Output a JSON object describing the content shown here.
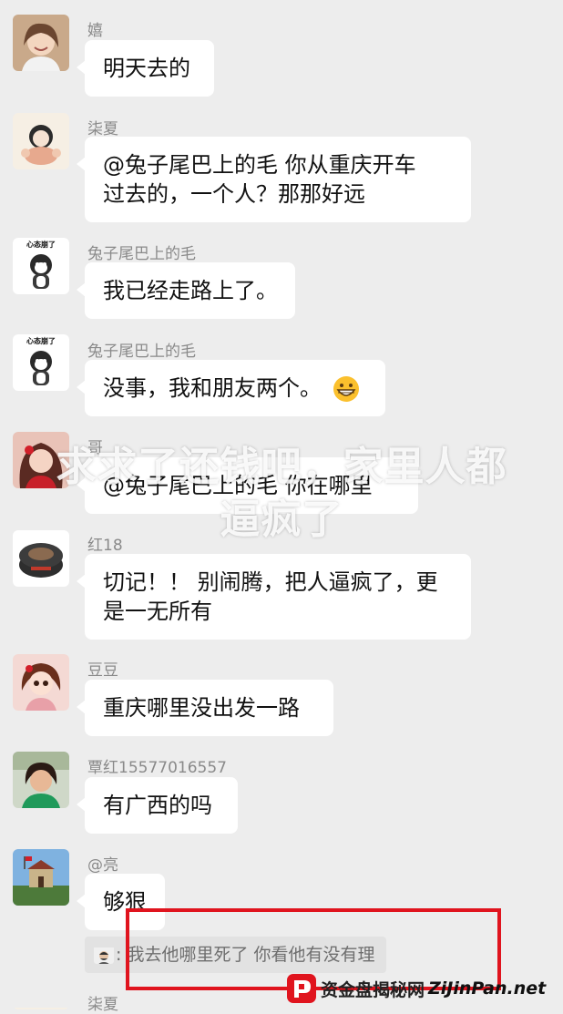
{
  "messages": [
    {
      "name": "嬉",
      "lines": [
        "明天去的"
      ]
    },
    {
      "name": "柒夏",
      "lines": [
        "@兔子尾巴上的毛  你从重庆开车",
        "过去的，一个人？那那好远"
      ]
    },
    {
      "name": "兔子尾巴上的毛",
      "lines": [
        "我已经走路上了。"
      ],
      "avatar_caption": "心态崩了"
    },
    {
      "name": "兔子尾巴上的毛",
      "lines": [
        "没事，我和朋友两个。"
      ],
      "avatar_caption": "心态崩了",
      "emoji": "grinning-face-emoji"
    },
    {
      "name": "哥",
      "lines": [
        "@兔子尾巴上的毛  你在哪里"
      ]
    },
    {
      "name": "红18",
      "lines": [
        "切记！！ 别闹腾，把人逼疯了，更",
        "是一无所有"
      ]
    },
    {
      "name": "豆豆",
      "lines": [
        "重庆哪里没出发一路"
      ]
    },
    {
      "name": "覃红15577016557",
      "lines": [
        "有广西的吗"
      ]
    },
    {
      "name": "@亮",
      "lines": [
        "够狠"
      ]
    },
    {
      "name": "柒夏",
      "lines": []
    }
  ],
  "quote": {
    "text": "我去他哪里死了  你看他有没有理"
  },
  "overlay": {
    "line1": "求求了还钱吧，家里人都",
    "line2": "逼疯了"
  },
  "watermark": {
    "text": "资金盘揭秘网",
    "site": "ZiJinPan.net"
  },
  "colors": {
    "background": "#ededed",
    "bubble": "#ffffff",
    "highlight_box": "#e0141e",
    "watermark_red": "#e0141e"
  }
}
